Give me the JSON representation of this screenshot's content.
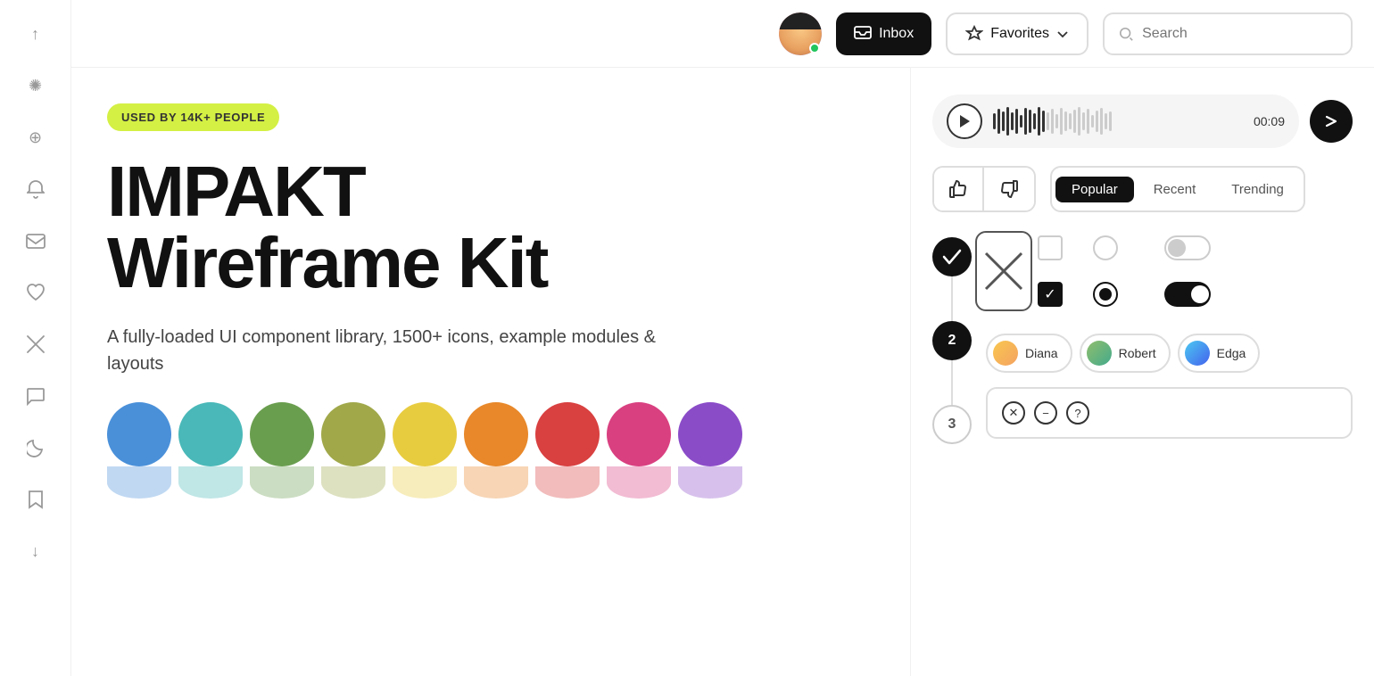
{
  "sidebar": {
    "icons": [
      {
        "name": "up-arrow-icon",
        "symbol": "↑"
      },
      {
        "name": "sun-icon",
        "symbol": "✺"
      },
      {
        "name": "link-icon",
        "symbol": "⌖"
      },
      {
        "name": "bell-icon",
        "symbol": "🔔"
      },
      {
        "name": "mail-icon",
        "symbol": "✉"
      },
      {
        "name": "heart-icon",
        "symbol": "♡"
      },
      {
        "name": "twitter-icon",
        "symbol": "𝕏"
      },
      {
        "name": "chat-icon",
        "symbol": "💬"
      },
      {
        "name": "moon-icon",
        "symbol": "☽"
      },
      {
        "name": "bookmark-icon",
        "symbol": "🔖"
      },
      {
        "name": "down-arrow-icon",
        "symbol": "↓"
      }
    ]
  },
  "header": {
    "inbox_label": "Inbox",
    "favorites_label": "Favorites",
    "search_placeholder": "Search"
  },
  "hero": {
    "badge": "USED BY 14K+ PEOPLE",
    "title_line1": "IMPAKT",
    "title_line2": "Wireframe Kit",
    "description": "A fully-loaded UI component library, 1500+ icons, example modules & layouts"
  },
  "audio": {
    "time": "00:09"
  },
  "tabs": {
    "items": [
      {
        "label": "Popular",
        "active": true
      },
      {
        "label": "Recent",
        "active": false
      },
      {
        "label": "Trending",
        "active": false
      }
    ]
  },
  "timeline": {
    "steps": [
      {
        "id": "check",
        "type": "check"
      },
      {
        "id": "2",
        "type": "filled",
        "label": "2"
      },
      {
        "id": "3",
        "type": "outlined",
        "label": "3"
      }
    ]
  },
  "swatches": [
    {
      "solid": "#4a90d9",
      "light": "#b3d1f0"
    },
    {
      "solid": "#4ab8b8",
      "light": "#b3e5e5"
    },
    {
      "solid": "#6a9e4f",
      "light": "#c2ddb4"
    },
    {
      "solid": "#a0a84a",
      "light": "#d8dca8"
    },
    {
      "solid": "#e8cc40",
      "light": "#f5e9a8"
    },
    {
      "solid": "#e8882a",
      "light": "#f5cfa0"
    },
    {
      "solid": "#d94040",
      "light": "#f0b0b0"
    },
    {
      "solid": "#d94080",
      "light": "#f0b0cc"
    },
    {
      "solid": "#8b4cc8",
      "light": "#cdb0e8"
    }
  ],
  "users": [
    {
      "name": "Diana",
      "class": "diana"
    },
    {
      "name": "Robert",
      "class": "robert"
    },
    {
      "name": "Edga",
      "class": "edga"
    }
  ],
  "window_controls": [
    {
      "symbol": "✕"
    },
    {
      "symbol": "−"
    },
    {
      "symbol": "?"
    }
  ]
}
